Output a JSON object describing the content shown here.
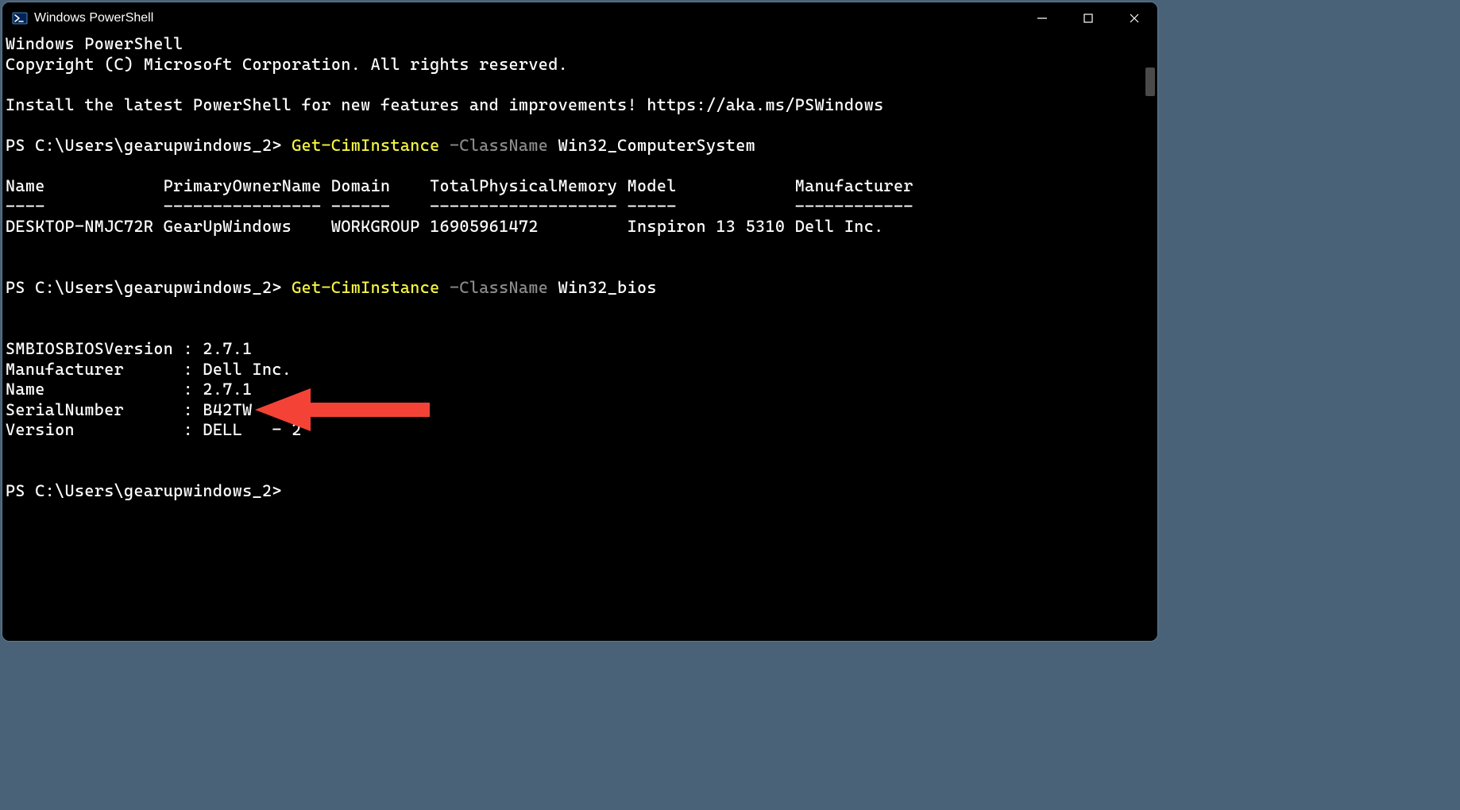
{
  "window": {
    "title": "Windows PowerShell"
  },
  "banner": {
    "line1": "Windows PowerShell",
    "line2": "Copyright (C) Microsoft Corporation. All rights reserved.",
    "install_hint": "Install the latest PowerShell for new features and improvements! https://aka.ms/PSWindows"
  },
  "prompt": "PS C:\\Users\\gearupwindows_2>",
  "command1": {
    "cmdlet": " Get-CimInstance",
    "param_flag": " -ClassName",
    "param_value": " Win32_ComputerSystem"
  },
  "table1": {
    "header_line": "Name            PrimaryOwnerName Domain    TotalPhysicalMemory Model            Manufacturer",
    "divider_line": "----            ---------------- ------    ------------------- -----            ------------",
    "row_line": "DESKTOP-NMJC72R GearUpWindows    WORKGROUP 16905961472         Inspiron 13 5310 Dell Inc."
  },
  "command2": {
    "cmdlet": " Get-CimInstance",
    "param_flag": " -ClassName",
    "param_value": " Win32_bios"
  },
  "bios_output": {
    "line1": "SMBIOSBIOSVersion : 2.7.1",
    "line2": "Manufacturer      : Dell Inc.",
    "line3": "Name              : 2.7.1",
    "line4": "SerialNumber      : B42TW",
    "line5": "Version           : DELL   - 2"
  }
}
